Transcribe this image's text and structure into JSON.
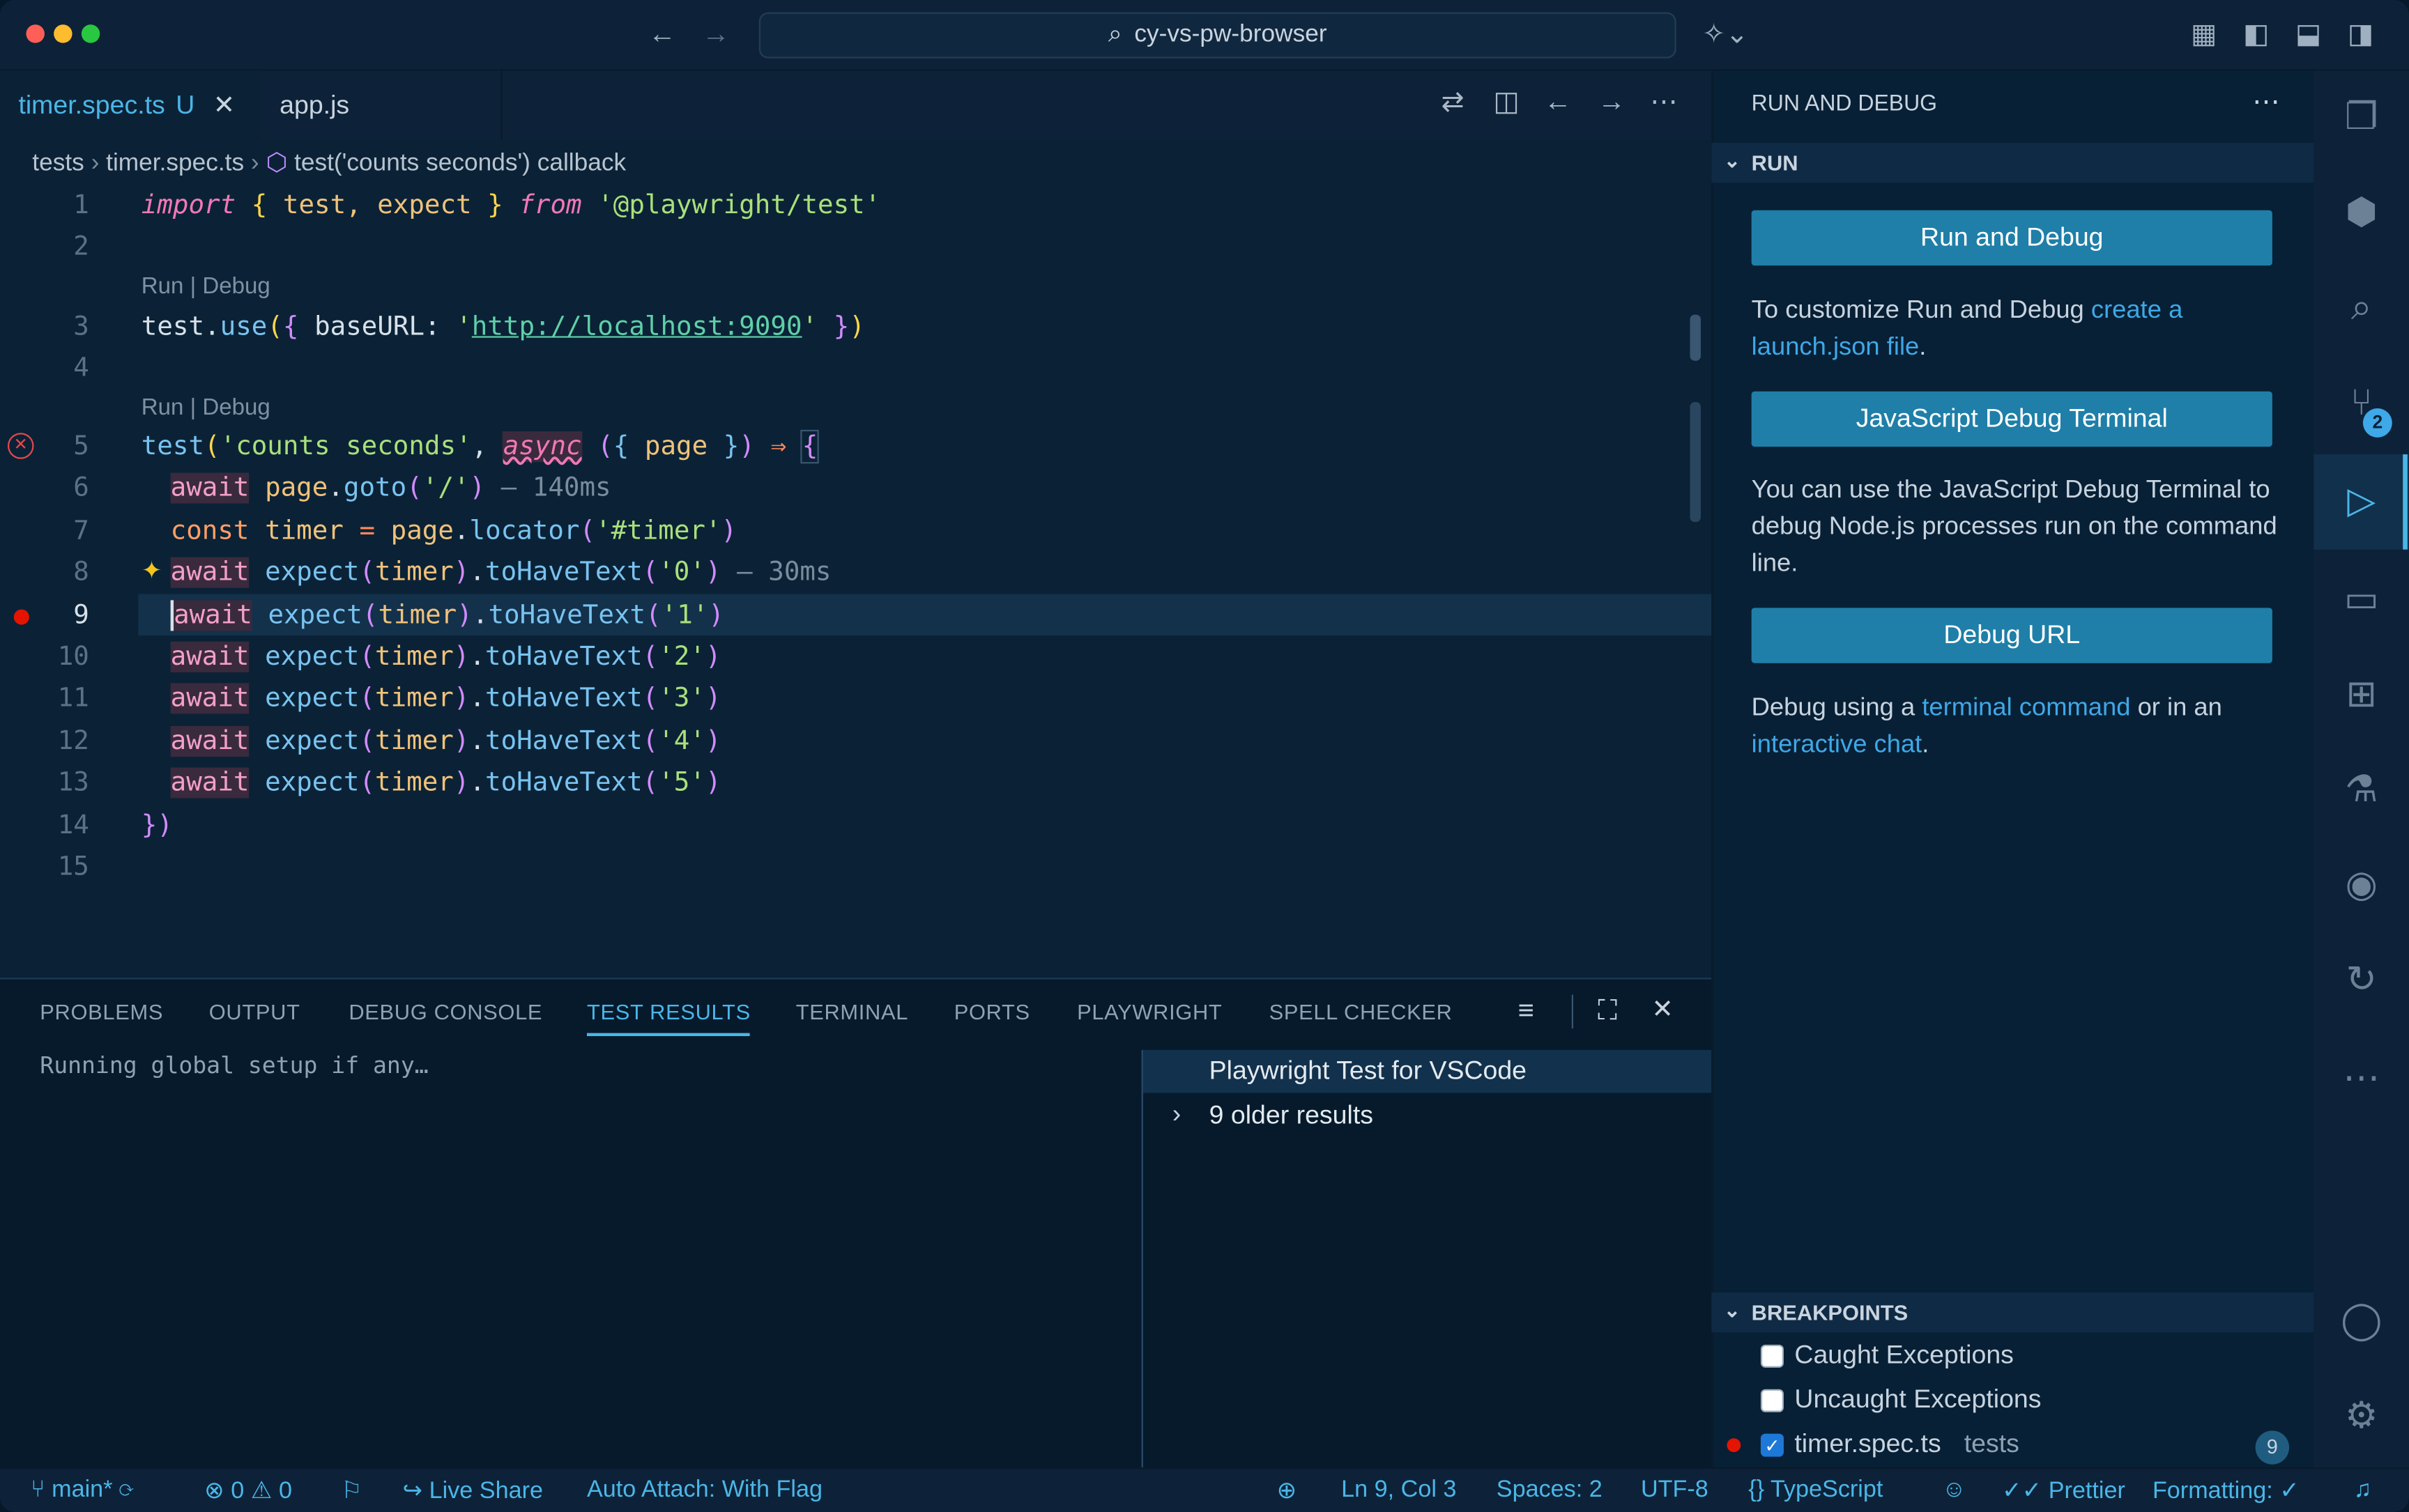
{
  "window": {
    "search_text": "cy-vs-pw-browser",
    "traffic_colors": [
      "#ff5f57",
      "#febc2e",
      "#28c840"
    ]
  },
  "tabs": [
    {
      "label": "timer.spec.ts",
      "badge": "U"
    },
    {
      "label": "app.js"
    }
  ],
  "breadcrumb": {
    "part1": "tests",
    "part2": "timer.spec.ts",
    "part3": "test('counts seconds') callback"
  },
  "editor": {
    "codelens": "Run | Debug",
    "line_numbers": [
      "1",
      "2",
      "3",
      "4",
      "5",
      "6",
      "7",
      "8",
      "9",
      "10",
      "11",
      "12",
      "13",
      "14",
      "15"
    ],
    "line1": {
      "kw1": "import",
      "mid": " test, expect ",
      "kw2": "from",
      "str": "'@playwright/test'",
      "open": "{",
      "close": "}"
    },
    "line3": {
      "obj": "test",
      "fn": "use",
      "key": "baseURL",
      "url": "http://localhost:9090"
    },
    "line5": {
      "fn": "test",
      "str": "'counts seconds'",
      "kw": "async",
      "param": "page",
      "arrow": "⇒"
    },
    "line6": {
      "kw": "await",
      "obj": "page",
      "fn": "goto",
      "str": "'/'",
      "hint": "— 140ms"
    },
    "line7": {
      "kw": "const",
      "var": "timer",
      "obj": "page",
      "fn": "locator",
      "str": "'#timer'"
    },
    "line8": {
      "kw": "await",
      "fn": "expect",
      "var": "timer",
      "m": "toHaveText",
      "str": "'0'",
      "hint": "— 30ms"
    },
    "line9": {
      "kw": "await",
      "fn": "expect",
      "var": "timer",
      "m": "toHaveText",
      "str": "'1'"
    },
    "line10": {
      "kw": "await",
      "fn": "expect",
      "var": "timer",
      "m": "toHaveText",
      "str": "'2'"
    },
    "line11": {
      "kw": "await",
      "fn": "expect",
      "var": "timer",
      "m": "toHaveText",
      "str": "'3'"
    },
    "line12": {
      "kw": "await",
      "fn": "expect",
      "var": "timer",
      "m": "toHaveText",
      "str": "'4'"
    },
    "line13": {
      "kw": "await",
      "fn": "expect",
      "var": "timer",
      "m": "toHaveText",
      "str": "'5'"
    },
    "line14": "})"
  },
  "panel": {
    "tabs": [
      "PROBLEMS",
      "OUTPUT",
      "DEBUG CONSOLE",
      "TEST RESULTS",
      "TERMINAL",
      "PORTS",
      "PLAYWRIGHT",
      "SPELL CHECKER"
    ],
    "log": "Running global setup if any…",
    "results": [
      "Playwright Test for VSCode",
      "9 older results"
    ]
  },
  "sidebar": {
    "title": "RUN AND DEBUG",
    "run_section": "RUN",
    "run_button": "Run and Debug",
    "customize_pre": "To customize Run and Debug ",
    "customize_link": "create a launch.json file",
    "customize_post": ".",
    "js_terminal_button": "JavaScript Debug Terminal",
    "js_terminal_text": "You can use the JavaScript Debug Terminal to debug Node.js processes run on the command line.",
    "debug_url_button": "Debug URL",
    "debug_text_pre": "Debug using a ",
    "debug_link1": "terminal command",
    "debug_text_mid": " or in an ",
    "debug_link2": "interactive chat",
    "debug_text_post": ".",
    "breakpoints_section": "BREAKPOINTS",
    "breakpoints": [
      {
        "label": "Caught Exceptions",
        "checked": false
      },
      {
        "label": "Uncaught Exceptions",
        "checked": false
      },
      {
        "label": "timer.spec.ts",
        "detail": "tests",
        "checked": true,
        "count": "9"
      }
    ]
  },
  "activity": {
    "scm_badge": "2"
  },
  "status": {
    "branch": "main*",
    "errors": "0",
    "warnings": "0",
    "live_share": "Live Share",
    "auto_attach": "Auto Attach: With Flag",
    "position": "Ln 9, Col 3",
    "spaces": "Spaces: 2",
    "encoding": "UTF-8",
    "language": "TypeScript",
    "prettier": "Prettier",
    "formatting": "Formatting: ✓"
  }
}
